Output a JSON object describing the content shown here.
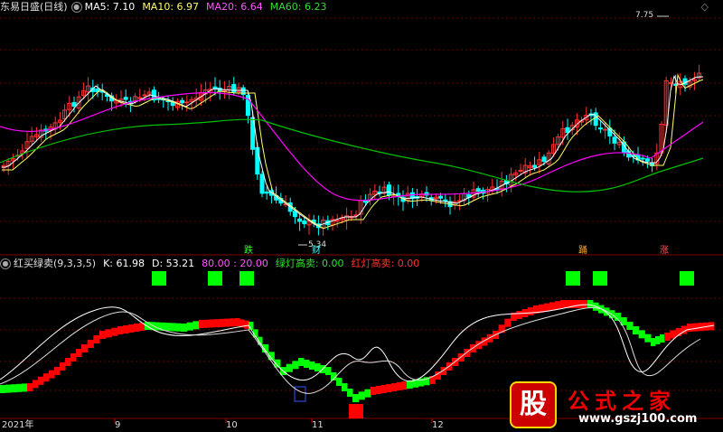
{
  "top_header": {
    "title": "东易日盛(日线)",
    "ma5": "MA5: 7.10",
    "ma10": "MA10: 6.97",
    "ma20": "MA20: 6.64",
    "ma60": "MA60: 6.23"
  },
  "ind_header": {
    "title": "红买绿卖(9,3,3,5)",
    "k": "K: 61.98",
    "d": "D: 53.21",
    "levels": "80.00 : 20.00",
    "green_sell": "绿灯高卖: 0.00",
    "red_sell": "红灯高卖: 0.00"
  },
  "price_labels": {
    "high": "7.75",
    "low": "5.34"
  },
  "signal_labels": [
    "跌",
    "财",
    "踊",
    "涨"
  ],
  "x_axis": [
    "2021年",
    "9",
    "10",
    "11",
    "12"
  ],
  "watermark": {
    "logo": "股",
    "title": "公式之家",
    "url": "www.gszj100.com"
  },
  "colors": {
    "up": "#ff3030",
    "down": "#00ffff",
    "ma5": "#ffffff",
    "ma10": "#ffff66",
    "ma20": "#ff00ff",
    "ma60": "#00c000",
    "red_step": "#ff0000",
    "green_step": "#00ff00"
  }
}
